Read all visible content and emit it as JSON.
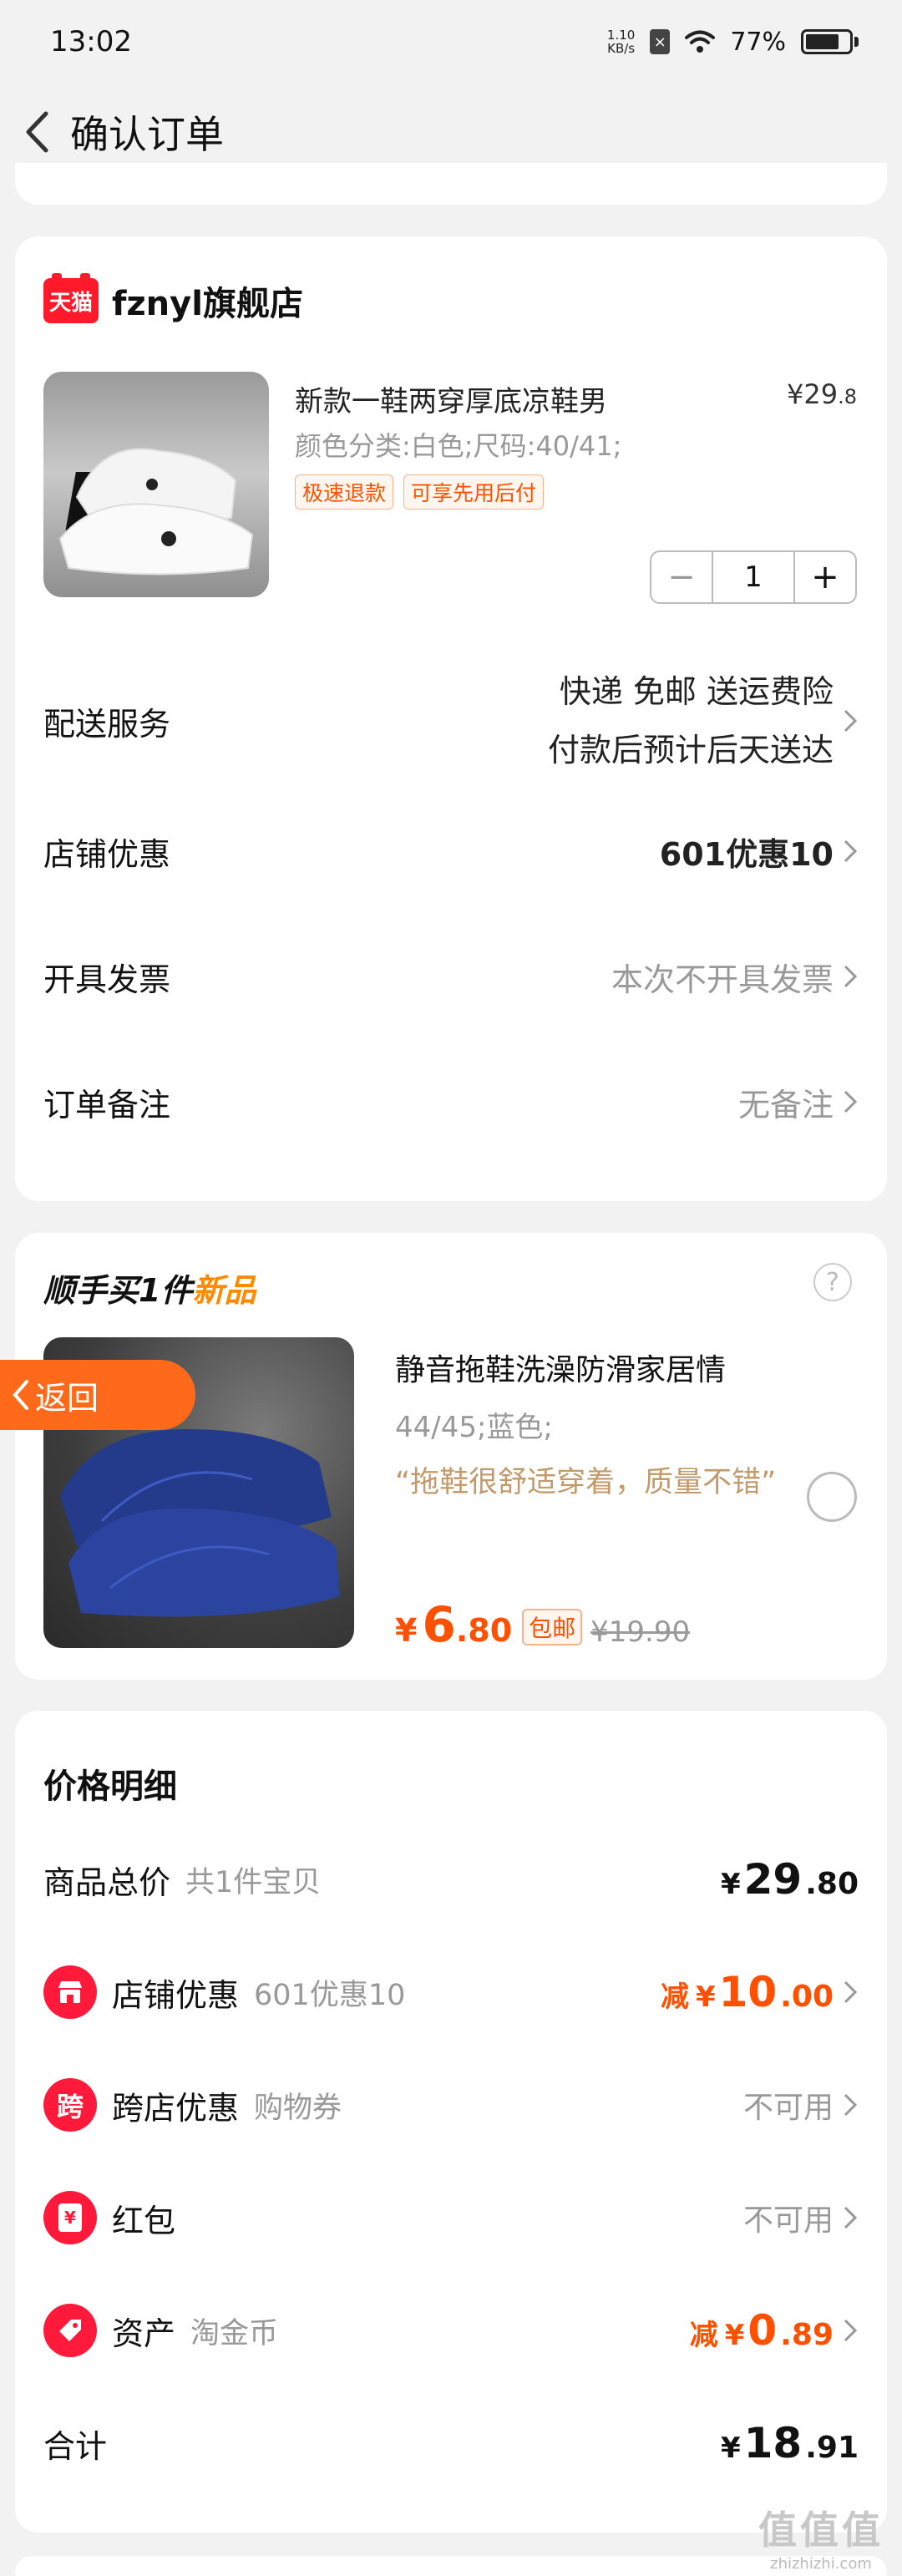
{
  "status_bar": {
    "time": "13:02",
    "net_speed_value": "1.10",
    "net_speed_unit": "KB/s",
    "battery": "77%",
    "battery_level": 0.77
  },
  "header": {
    "title": "确认订单"
  },
  "store": {
    "logo_text": "天猫",
    "name": "fznyl旗舰店",
    "product": {
      "title": "新款一鞋两穿厚底凉鞋男",
      "price_int": "¥29",
      "price_dec": ".8",
      "sku": "颜色分类:白色;尺码:40/41;",
      "tags": [
        "极速退款",
        "可享先用后付"
      ],
      "quantity": "1",
      "minus": "−",
      "plus": "+"
    },
    "rows": {
      "delivery_label": "配送服务",
      "delivery_line1": "快递 免邮 送运费险",
      "delivery_line2": "付款后预计后天送达",
      "discount_label": "店铺优惠",
      "discount_value": "601优惠10",
      "invoice_label": "开具发票",
      "invoice_value": "本次不开具发票",
      "note_label": "订单备注",
      "note_value": "无备注"
    }
  },
  "addon": {
    "title_prefix": "顺手买1件",
    "title_new": "新品",
    "help": "?",
    "return_label": "返回",
    "name": "静音拖鞋洗澡防滑家居情",
    "sku": "44/45;蓝色;",
    "review": "“拖鞋很舒适穿着，质量不错”",
    "price_cur": "¥",
    "price_int": "6",
    "price_dec": ".80",
    "free_ship": "包邮",
    "orig_price": "¥19.90"
  },
  "price_detail": {
    "title": "价格明细",
    "total_label": "商品总价",
    "total_sub": "共1件宝贝",
    "total_cur": "¥",
    "total_int": "29",
    "total_dec": ".80",
    "store_label": "店铺优惠",
    "store_sub": "601优惠10",
    "store_jian": "减",
    "store_cur": "¥",
    "store_int": "10",
    "store_dec": ".00",
    "cross_icon": "跨",
    "cross_label": "跨店优惠",
    "cross_sub": "购物券",
    "cross_value": "不可用",
    "redpacket_icon": "¥",
    "redpacket_label": "红包",
    "redpacket_value": "不可用",
    "asset_label": "资产",
    "asset_sub": "淘金币",
    "asset_jian": "减",
    "asset_cur": "¥",
    "asset_int": "0",
    "asset_dec": ".89",
    "sum_label": "合计",
    "sum_cur": "¥",
    "sum_int": "18",
    "sum_dec": ".91"
  },
  "watermark": {
    "big": "值值值",
    "small": "zhizhizhi.com"
  },
  "colors": {
    "accent": "#ff5000",
    "tmall_red": "#ff1a2b",
    "review": "#c39a6b",
    "return_btn": "#ff6a1a"
  }
}
